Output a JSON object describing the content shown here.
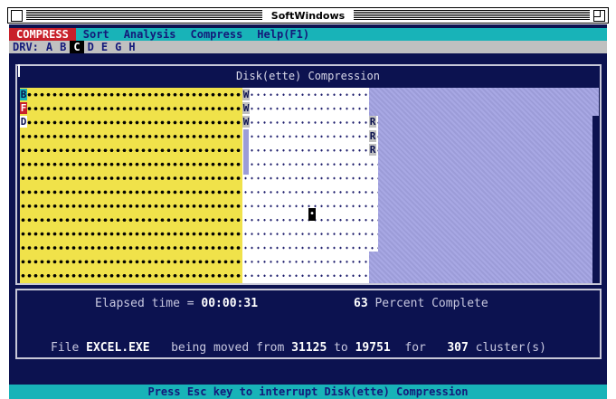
{
  "window": {
    "title": "SoftWindows"
  },
  "menu": {
    "items": [
      {
        "label": "COMPRESS",
        "active": true
      },
      {
        "label": "Sort"
      },
      {
        "label": "Analysis"
      },
      {
        "label": "Compress"
      },
      {
        "label": "Help(F1)"
      }
    ]
  },
  "drives": {
    "prefix": "DRV:",
    "items": [
      "A",
      "B",
      "C",
      "D",
      "E",
      "G",
      "H"
    ],
    "selected": "C"
  },
  "map": {
    "title": "Disk(ette) Compression",
    "row_marks": [
      "B",
      "F",
      "D"
    ],
    "w_marks": [
      "W",
      "W",
      "W"
    ],
    "r_marks": [
      "R",
      "R",
      "R"
    ],
    "colors": {
      "used": "#f0e24a",
      "free": "#ffffff",
      "unused": "#a4a4e0",
      "background": "#0c1250"
    }
  },
  "status": {
    "elapsed_label": "Elapsed time = ",
    "elapsed_value": "00:00:31",
    "percent_value": "63",
    "percent_label": " Percent Complete",
    "file_label": "File ",
    "file_name": "EXCEL.EXE",
    "moved_label": "   being moved from ",
    "from_cluster": "31125",
    "to_label": " to ",
    "to_cluster": "19751",
    "for_label": "  for   ",
    "cluster_count": "307",
    "cluster_label": " cluster(s)"
  },
  "footer": {
    "hint": "Press Esc key to interrupt Disk(ette) Compression"
  }
}
